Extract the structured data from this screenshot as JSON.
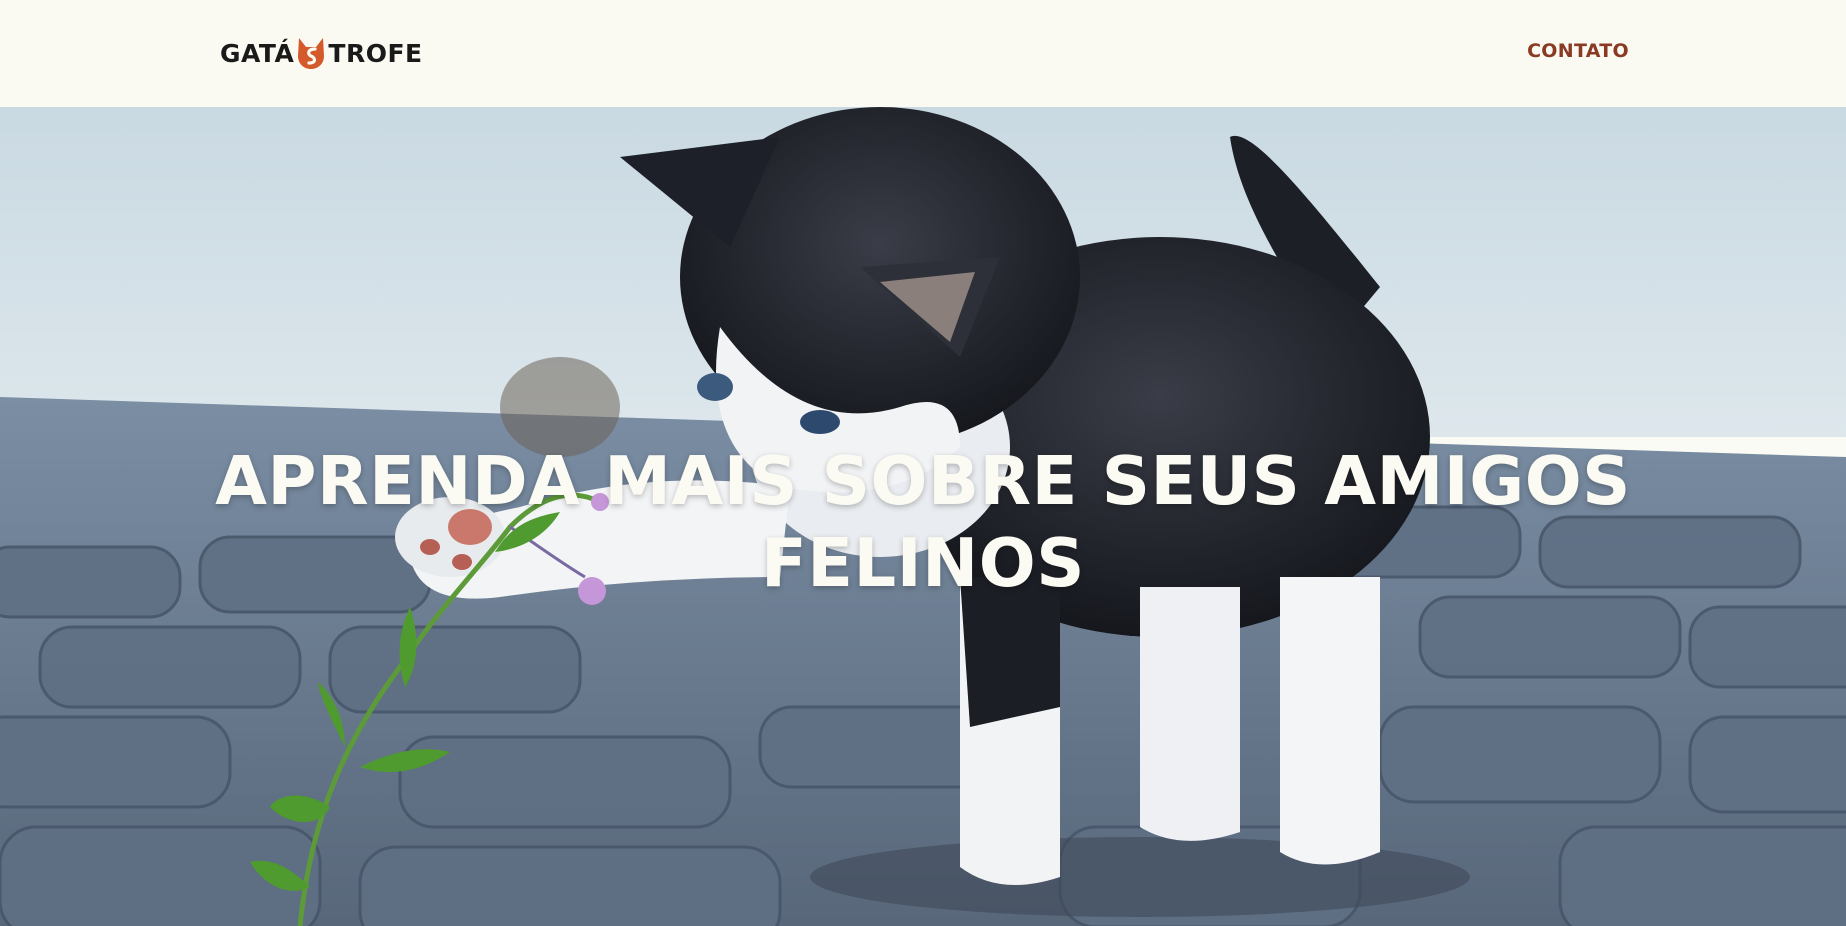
{
  "header": {
    "logo_left": "GATÁ",
    "logo_right": "TROFE",
    "nav": {
      "contact_label": "CONTATO"
    }
  },
  "hero": {
    "title_line1": "APRENDA MAIS SOBRE SEUS AMIGOS",
    "title_line2": "FELINOS",
    "image_icon": "kitten-photo"
  },
  "colors": {
    "header_bg": "#fafaf3",
    "accent": "#8a3a22",
    "logo_cat": "#d45a2c",
    "hero_text": "#fbfbf3"
  }
}
